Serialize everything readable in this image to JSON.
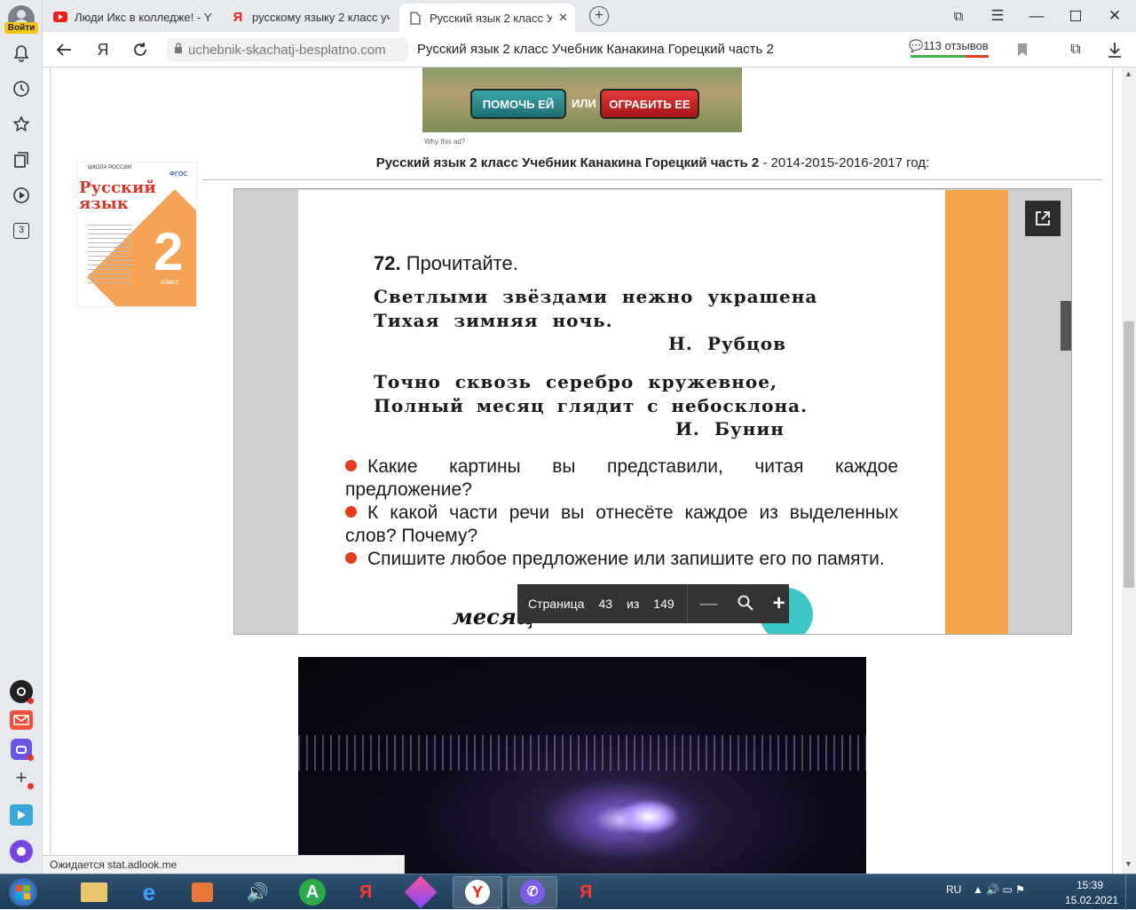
{
  "sidebar": {
    "login_label": "Войти",
    "badge_count": "3",
    "icons": [
      "avatar",
      "bell-icon",
      "history-icon",
      "star-icon",
      "collections-icon",
      "video-icon",
      "counter-icon",
      "alice-icon",
      "mail-icon",
      "messenger-icon",
      "add-icon",
      "play-icon",
      "circle-icon"
    ]
  },
  "tabs": [
    {
      "title": "Люди Икс в колледже! - Y",
      "icon": "youtube-icon",
      "active": false
    },
    {
      "title": "русскому языку 2 класс уч",
      "icon": "yandex-icon",
      "active": false
    },
    {
      "title": "Русский язык 2 класс Уче",
      "icon": "document-icon",
      "active": true
    }
  ],
  "toolbar": {
    "url": "uchebnik-skachatj-besplatno.com",
    "page_title": "Русский язык 2 класс Учебник Канакина Горецкий часть 2",
    "reviews": "113 отзывов"
  },
  "ad": {
    "help_label": "ПОМОЧЬ ЕЙ",
    "or_label": "ИЛИ",
    "rob_label": "ОГРАБИТЬ ЕЕ",
    "why_label": "Why this ad?"
  },
  "book_cover": {
    "series": "ШКОЛА РОССИИ",
    "title": "Русский язык",
    "grade": "2",
    "grade_word": "класс",
    "fgos": "ФГОС"
  },
  "headline": {
    "bold": "Русский язык 2 класс Учебник Канакина Горецкий часть 2",
    "rest": " - 2014-2015-2016-2017 год:"
  },
  "textbook": {
    "num": "72.",
    "task": "Прочитайте.",
    "poem1": [
      "Светлыми звёздами нежно украшена",
      "Тихая зимняя ночь."
    ],
    "author1": "Н. Рубцов",
    "poem2": [
      "Точно сквозь серебро кружевное,",
      "Полный месяц глядит с небосклона."
    ],
    "author2": "И. Бунин",
    "questions": [
      "Какие картины вы представили, читая каждое предложение?",
      "К какой части речи вы отнесёте каждое из выделенных слов? Почему?",
      "Спишите любое предложение или запишите его по памяти."
    ],
    "word": "месяц"
  },
  "pager": {
    "label": "Страница",
    "current": "43",
    "of": "из",
    "total": "149"
  },
  "status": "Ожидается stat.adlook.me",
  "tray": {
    "lang": "RU",
    "time": "15:39",
    "date": "15.02.2021"
  },
  "colors": {
    "accent_orange": "#f7a54a",
    "bullet_red": "#e63b1d",
    "taskbar": "#1e3b57"
  }
}
